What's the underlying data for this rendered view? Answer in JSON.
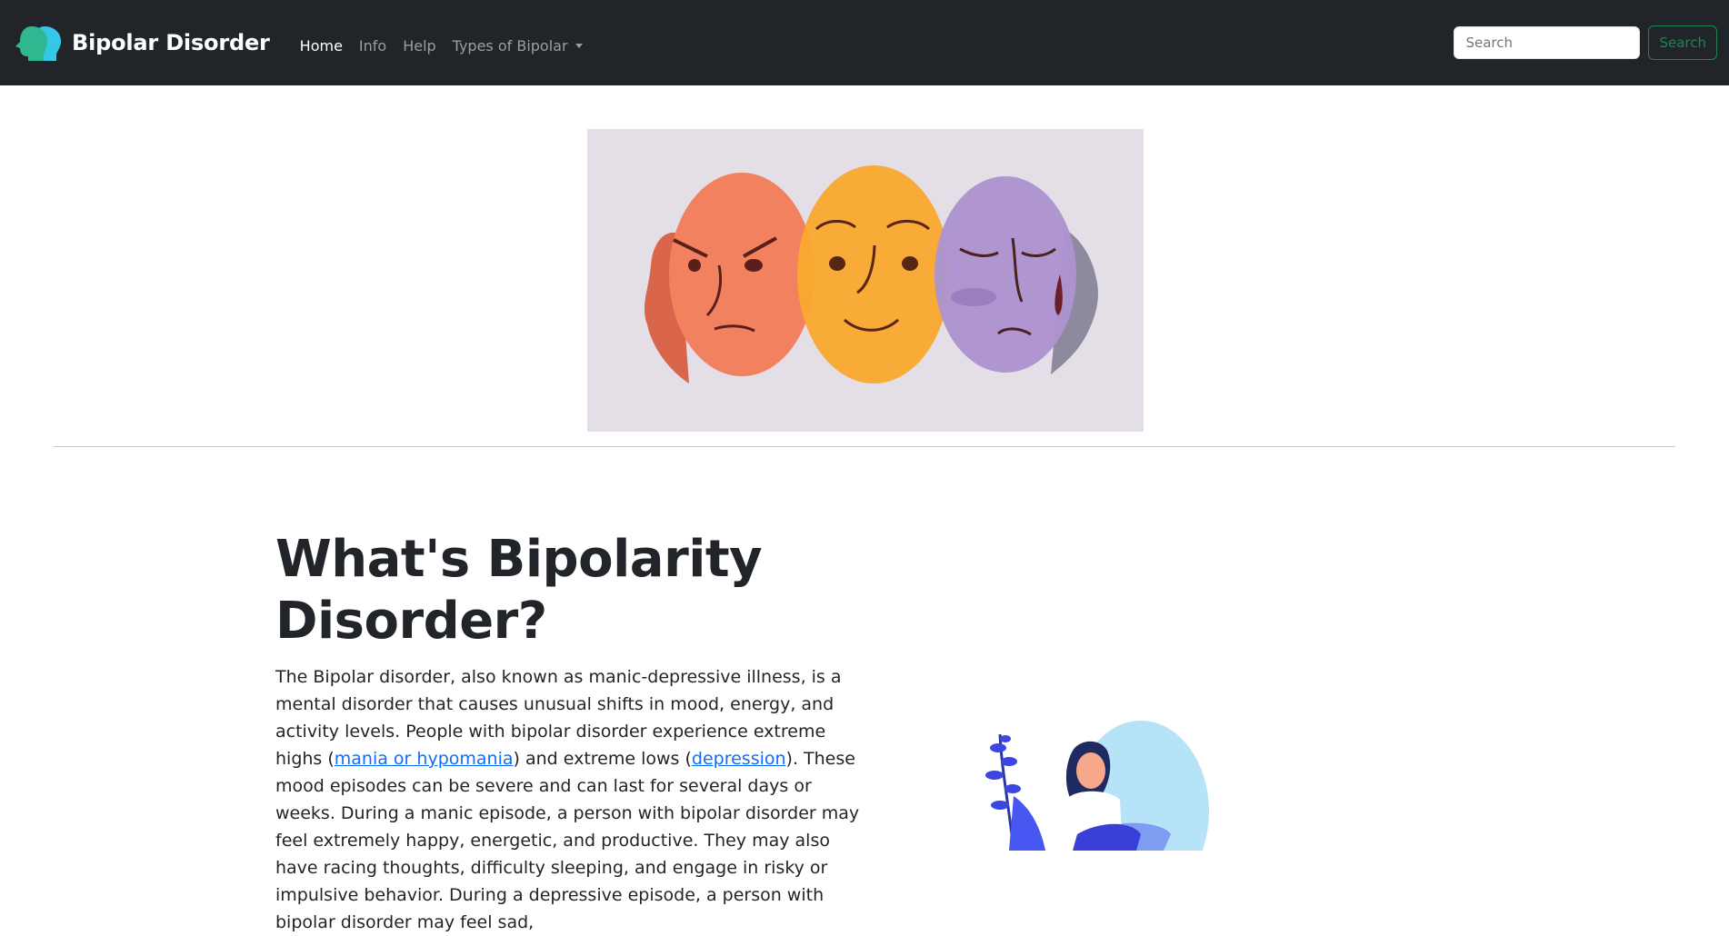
{
  "navbar": {
    "brand": "Bipolar Disorder",
    "logo_icon": "two-heads-logo-icon",
    "links": [
      {
        "label": "Home",
        "active": true
      },
      {
        "label": "Info",
        "active": false
      },
      {
        "label": "Help",
        "active": false
      }
    ],
    "dropdown": {
      "label": "Types of Bipolar"
    },
    "search": {
      "placeholder": "Search",
      "button_label": "Search"
    }
  },
  "hero_image": {
    "subject": "three mood faces: angry orange, happy yellow, sad purple"
  },
  "main": {
    "title": "What's Bipolarity Disorder?",
    "paragraph": {
      "t1": "The Bipolar disorder, also known as manic-depressive illness, is a mental disorder that causes unusual shifts in mood, energy, and activity levels. People with bipolar disorder experience extreme highs (",
      "link1": "mania or hypomania",
      "t2": ") and extreme lows (",
      "link2": "depression",
      "t3": "). These mood episodes can be severe and can last for several days or weeks. During a manic episode, a person with bipolar disorder may feel extremely happy, energetic, and productive. They may also have racing thoughts, difficulty sleeping, and engage in risky or impulsive behavior. During a depressive episode, a person with bipolar disorder may feel sad,"
    }
  },
  "colors": {
    "navbar_bg": "#212529",
    "link": "#0d6efd",
    "search_button": "#198754",
    "hero_bg": "#e4dfe7"
  }
}
